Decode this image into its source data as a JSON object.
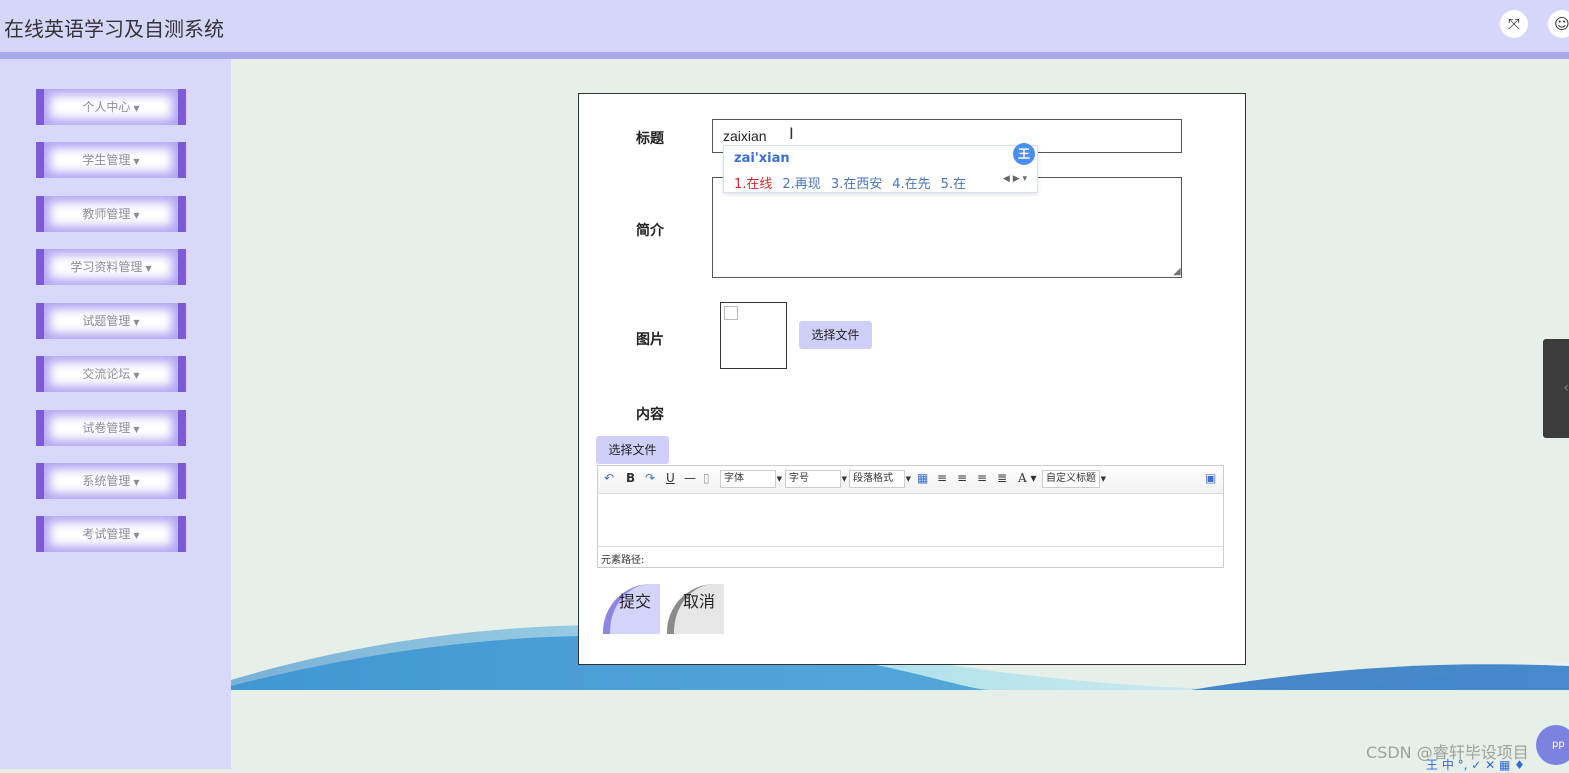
{
  "header": {
    "title": "在线英语学习及自测系统"
  },
  "sidebar": {
    "items": [
      {
        "label": "个人中心"
      },
      {
        "label": "学生管理"
      },
      {
        "label": "教师管理"
      },
      {
        "label": "学习资料管理"
      },
      {
        "label": "试题管理"
      },
      {
        "label": "交流论坛"
      },
      {
        "label": "试卷管理"
      },
      {
        "label": "系统管理"
      },
      {
        "label": "考试管理"
      }
    ]
  },
  "form": {
    "title_label": "标题",
    "title_value": "zaixian",
    "intro_label": "简介",
    "image_label": "图片",
    "image_choose_label": "选择文件",
    "content_label": "内容",
    "content_choose_label": "选择文件",
    "submit_label": "提交",
    "cancel_label": "取消"
  },
  "ime": {
    "pinyin": "zai'xian",
    "candidates": [
      "1.在线",
      "2.再现",
      "3.在西安",
      "4.在先",
      "5.在"
    ],
    "badge": "王"
  },
  "editor": {
    "font_family": "字体",
    "font_size": "字号",
    "paragraph_format": "段落格式",
    "custom_heading": "自定义标题",
    "path_label": "元素路径:"
  },
  "footer": {
    "watermark": "CSDN @睿轩毕设项目",
    "app_badge": "pp",
    "ime_tray": "王 中 °, ✓ ✕ ▦ ♦"
  },
  "icons": [
    "fullscreen-icon",
    "user-icon",
    "undo-icon",
    "redo-icon",
    "bold-icon",
    "underline-icon",
    "horizontal-rule-icon",
    "table-icon",
    "align-left-icon",
    "align-center-icon",
    "align-right-icon",
    "justify-icon",
    "font-color-icon",
    "preview-icon",
    "text-cursor-icon"
  ]
}
